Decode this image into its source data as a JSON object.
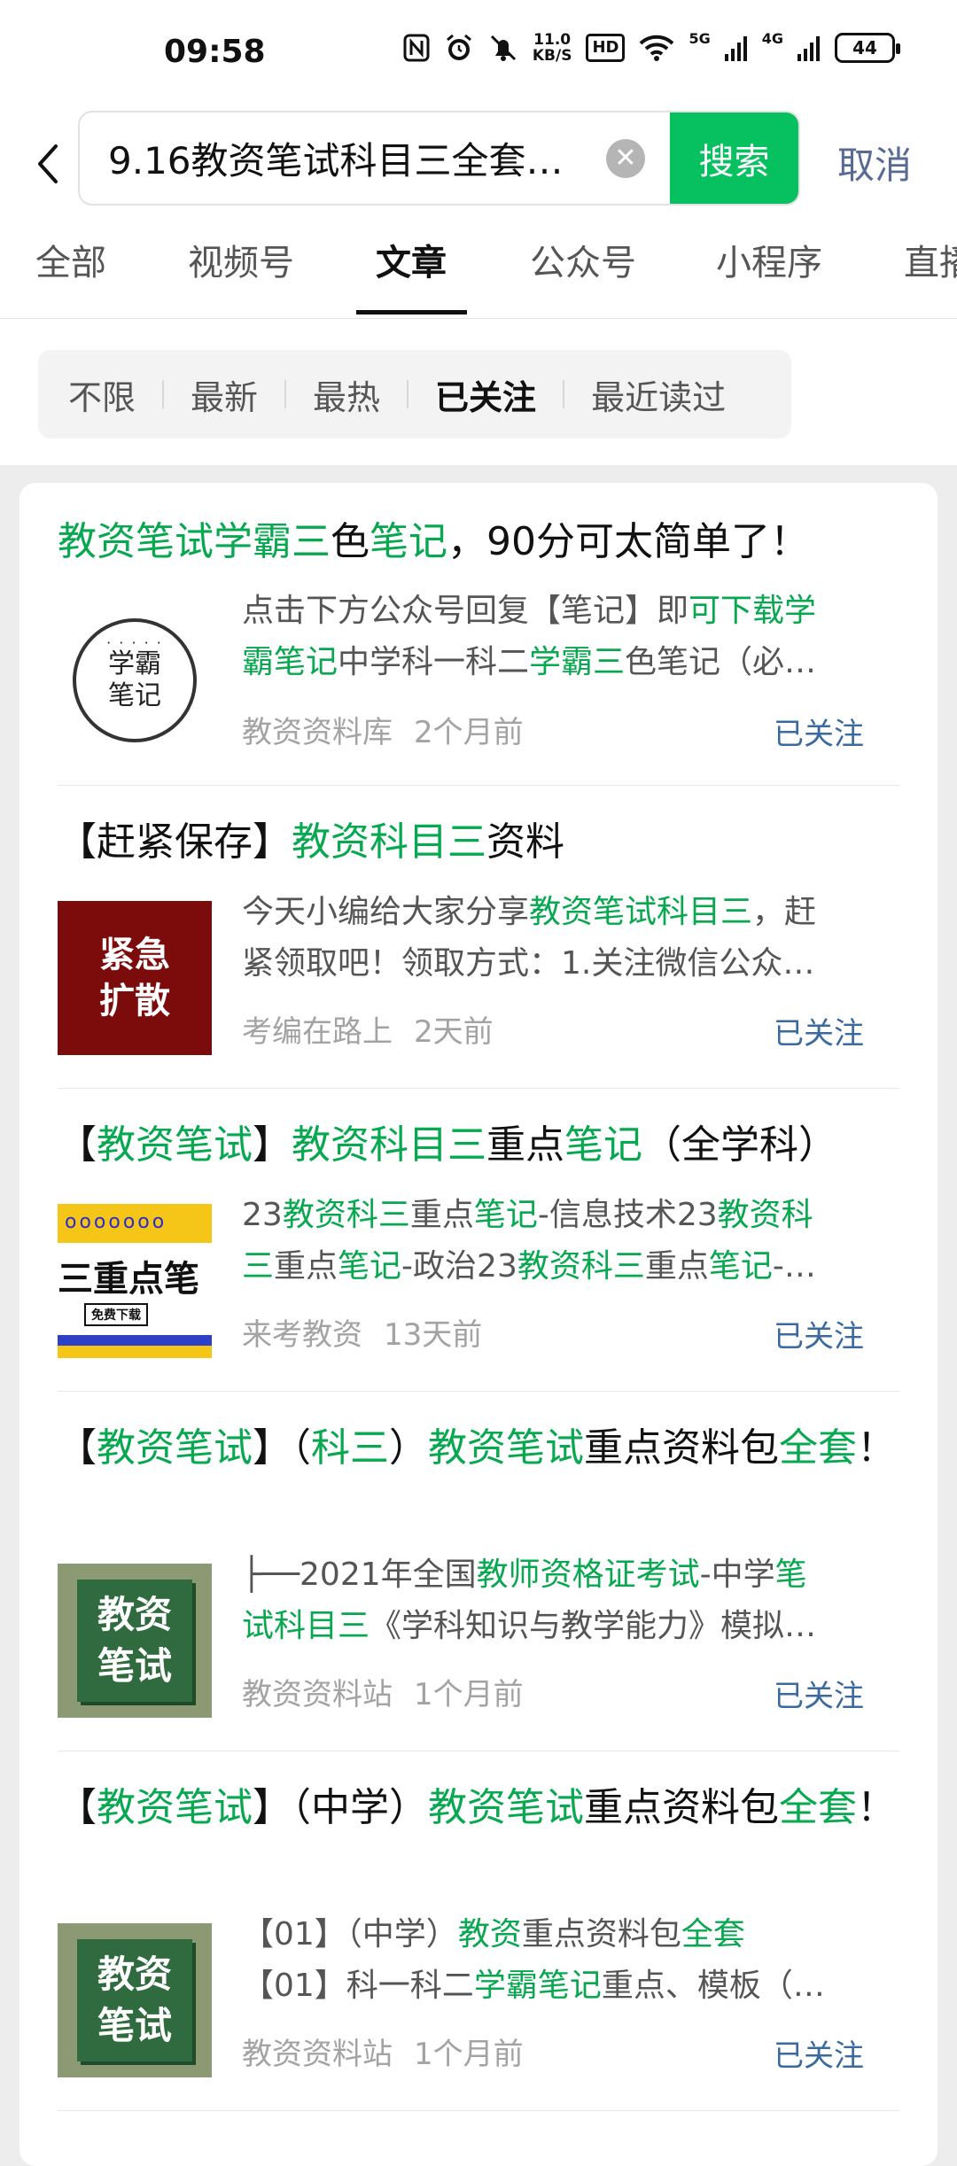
{
  "status_bar": {
    "time": "09:58",
    "netspeed_value": "11.0",
    "netspeed_unit": "KB/S",
    "hd_label": "HD",
    "sig1_label": "5G",
    "sig2_label": "4G",
    "battery": "44"
  },
  "search": {
    "query": "9.16教资笔试科目三全套…",
    "search_label": "搜索",
    "cancel_label": "取消"
  },
  "tabs": [
    "全部",
    "视频号",
    "文章",
    "公众号",
    "小程序",
    "直播"
  ],
  "active_tab": "文章",
  "filters": [
    "不限",
    "最新",
    "最热",
    "已关注",
    "最近读过"
  ],
  "selected_filter": "已关注",
  "results": [
    {
      "title_parts": [
        {
          "t": "教资笔试学霸三",
          "h": true
        },
        {
          "t": "色",
          "h": false
        },
        {
          "t": "笔记",
          "h": true
        },
        {
          "t": "，90分可太简单了！",
          "h": false
        }
      ],
      "thumb_text": [
        "学霸",
        "笔记"
      ],
      "snippet_line1": [
        {
          "t": "点击下方公众号回复【笔记】即",
          "h": false
        },
        {
          "t": "可下载学",
          "h": true
        }
      ],
      "snippet_line2": [
        {
          "t": "霸笔记",
          "h": true
        },
        {
          "t": "中学科一科二",
          "h": false
        },
        {
          "t": "学霸三",
          "h": true
        },
        {
          "t": "色笔记（必…",
          "h": false
        }
      ],
      "source": "教资资料库",
      "time": "2个月前",
      "follow": "已关注"
    },
    {
      "title_parts": [
        {
          "t": "【赶紧保存】",
          "h": false
        },
        {
          "t": "教资科目三",
          "h": true
        },
        {
          "t": "资料",
          "h": false
        }
      ],
      "thumb_text": [
        "紧急",
        "扩散"
      ],
      "snippet_line1": [
        {
          "t": "今天小编给大家分享",
          "h": false
        },
        {
          "t": "教资笔试科目三",
          "h": true
        },
        {
          "t": "，赶",
          "h": false
        }
      ],
      "snippet_line2": [
        {
          "t": "紧领取吧！领取方式：1.关注微信公众…",
          "h": false
        }
      ],
      "source": "考编在路上",
      "time": "2天前",
      "follow": "已关注"
    },
    {
      "title_parts": [
        {
          "t": "【",
          "h": false
        },
        {
          "t": "教资笔试",
          "h": true
        },
        {
          "t": "】",
          "h": false
        },
        {
          "t": "教资科目三",
          "h": true
        },
        {
          "t": "重点",
          "h": false
        },
        {
          "t": "笔记",
          "h": true
        },
        {
          "t": "（全学科）",
          "h": false
        }
      ],
      "thumb_text": [
        "三重点笔",
        "免费下载"
      ],
      "snippet_line1": [
        {
          "t": "23",
          "h": false
        },
        {
          "t": "教资科三",
          "h": true
        },
        {
          "t": "重点",
          "h": false
        },
        {
          "t": "笔记",
          "h": true
        },
        {
          "t": "-信息技术23",
          "h": false
        },
        {
          "t": "教资科",
          "h": true
        }
      ],
      "snippet_line2": [
        {
          "t": "三",
          "h": true
        },
        {
          "t": "重点",
          "h": false
        },
        {
          "t": "笔记",
          "h": true
        },
        {
          "t": "-政治23",
          "h": false
        },
        {
          "t": "教资科三",
          "h": true
        },
        {
          "t": "重点",
          "h": false
        },
        {
          "t": "笔记",
          "h": true
        },
        {
          "t": "-…",
          "h": false
        }
      ],
      "source": "来考教资",
      "time": "13天前",
      "follow": "已关注"
    },
    {
      "title_parts": [
        {
          "t": "【",
          "h": false
        },
        {
          "t": "教资笔试",
          "h": true
        },
        {
          "t": "】（",
          "h": false
        },
        {
          "t": "科三",
          "h": true
        },
        {
          "t": "）",
          "h": false
        },
        {
          "t": "教资笔试",
          "h": true
        },
        {
          "t": "重点资料包",
          "h": false
        },
        {
          "t": "全套",
          "h": true
        },
        {
          "t": "！",
          "h": false
        }
      ],
      "thumb_text": [
        "教资",
        "笔试"
      ],
      "snippet_line1": [
        {
          "t": "├──2021年全国",
          "h": false
        },
        {
          "t": "教师资格证考试",
          "h": true
        },
        {
          "t": "-中学",
          "h": false
        },
        {
          "t": "笔",
          "h": true
        }
      ],
      "snippet_line2": [
        {
          "t": "试科目三",
          "h": true
        },
        {
          "t": "《学科知识与教学能力》模拟…",
          "h": false
        }
      ],
      "source": "教资资料站",
      "time": "1个月前",
      "follow": "已关注"
    },
    {
      "title_parts": [
        {
          "t": "【",
          "h": false
        },
        {
          "t": "教资笔试",
          "h": true
        },
        {
          "t": "】（中学）",
          "h": false
        },
        {
          "t": "教资笔试",
          "h": true
        },
        {
          "t": "重点资料包",
          "h": false
        },
        {
          "t": "全套",
          "h": true
        },
        {
          "t": "！",
          "h": false
        }
      ],
      "thumb_text": [
        "教资",
        "笔试"
      ],
      "snippet_line1": [
        {
          "t": "【01】（中学）",
          "h": false
        },
        {
          "t": "教资",
          "h": true
        },
        {
          "t": "重点资料包",
          "h": false
        },
        {
          "t": "全套",
          "h": true
        }
      ],
      "snippet_line2": [
        {
          "t": "【01】科一科二",
          "h": false
        },
        {
          "t": "学霸笔记",
          "h": true
        },
        {
          "t": "重点、模板（…",
          "h": false
        }
      ],
      "source": "教资资料站",
      "time": "1个月前",
      "follow": "已关注"
    }
  ],
  "colors": {
    "accent_green": "#07c160",
    "highlight": "#07a84f",
    "link_blue": "#576b95",
    "follow_blue": "#3b6aa0"
  }
}
